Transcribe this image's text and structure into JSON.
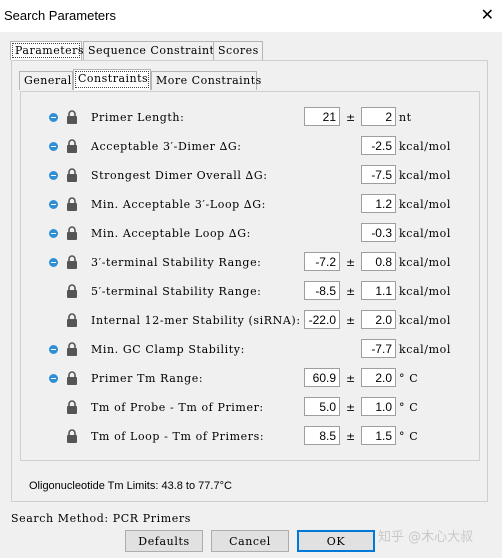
{
  "window": {
    "title": "Search Parameters",
    "close_glyph": "✕"
  },
  "top_tabs": [
    "Parameters",
    "Sequence Constraints",
    "Scores"
  ],
  "sub_tabs": [
    "General",
    "Constraints",
    "More Constraints"
  ],
  "rows": [
    {
      "mid": true,
      "label": "Primer Length:",
      "v1": "21",
      "v2": "2",
      "unit": "nt"
    },
    {
      "mid": true,
      "label": "Acceptable 3′-Dimer ∆G:",
      "v1": "",
      "v2": "-2.5",
      "unit": "kcal/mol"
    },
    {
      "mid": true,
      "label": "Strongest Dimer Overall ∆G:",
      "v1": "",
      "v2": "-7.5",
      "unit": "kcal/mol"
    },
    {
      "mid": true,
      "label": "Min. Acceptable 3′-Loop ∆G:",
      "v1": "",
      "v2": "1.2",
      "unit": "kcal/mol"
    },
    {
      "mid": true,
      "label": "Min. Acceptable Loop ∆G:",
      "v1": "",
      "v2": "-0.3",
      "unit": "kcal/mol"
    },
    {
      "mid": true,
      "label": "3′-terminal Stability Range:",
      "v1": "-7.2",
      "v2": "0.8",
      "unit": "kcal/mol"
    },
    {
      "mid": false,
      "label": "5′-terminal Stability Range:",
      "v1": "-8.5",
      "v2": "1.1",
      "unit": "kcal/mol"
    },
    {
      "mid": false,
      "label": "Internal 12-mer Stability (siRNA):",
      "v1": "-22.0",
      "v2": "2.0",
      "unit": "kcal/mol"
    },
    {
      "mid": true,
      "label": "Min. GC Clamp Stability:",
      "v1": "",
      "v2": "-7.7",
      "unit": "kcal/mol"
    },
    {
      "mid": true,
      "label": "Primer Tm Range:",
      "v1": "60.9",
      "v2": "2.0",
      "unit": "° C"
    },
    {
      "mid": false,
      "label": "Tm of Probe - Tm of Primer:",
      "v1": "5.0",
      "v2": "1.0",
      "unit": "° C"
    },
    {
      "mid": false,
      "label": "Tm of Loop - Tm of Primers:",
      "v1": "8.5",
      "v2": "1.5",
      "unit": "° C"
    }
  ],
  "pm_symbol": "±",
  "oligo_limits": "Oligonucleotide Tm Limits: 43.8 to 77.7°C",
  "search_method": "Search Method:  PCR Primers",
  "buttons": {
    "defaults": "Defaults",
    "cancel": "Cancel",
    "ok": "OK"
  },
  "watermark": "知乎 @木心大叔",
  "colors": {
    "midpoint_icon": "#2f8fd6",
    "ok_border": "#0078d7"
  }
}
